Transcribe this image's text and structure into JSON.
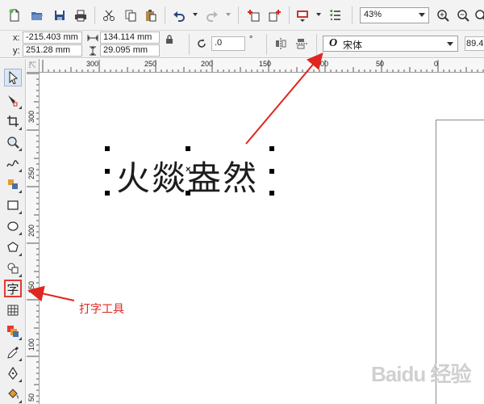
{
  "toolbar": {
    "zoom_value": "43%",
    "icons": [
      "new-document-icon",
      "open-folder-icon",
      "save-icon",
      "print-icon",
      "cut-icon",
      "copy-icon",
      "paste-icon",
      "undo-icon",
      "redo-icon",
      "import-icon",
      "export-icon",
      "application-launcher-icon",
      "options-icon",
      "zoom-in-icon",
      "zoom-out-icon"
    ]
  },
  "property_bar": {
    "x_label": "x:",
    "x_value": "-215.403 mm",
    "y_label": "y:",
    "y_value": "251.28 mm",
    "width_value": "134.114 mm",
    "height_value": "29.095 mm",
    "angle_value": ".0",
    "angle_unit": "°",
    "font_name": "宋体",
    "font_size": "89.4"
  },
  "toolbox": {
    "tools": [
      "pick-tool",
      "shape-tool",
      "crop-tool",
      "zoom-tool",
      "freehand-tool",
      "smart-fill-tool",
      "rectangle-tool",
      "ellipse-tool",
      "polygon-tool",
      "basic-shapes-tool",
      "text-tool",
      "table-tool",
      "interactive-effects-tool",
      "eyedropper-tool",
      "outline-tool",
      "fill-tool"
    ]
  },
  "ruler": {
    "h_labels": [
      "300",
      "250",
      "200",
      "150",
      "100",
      "50",
      "0"
    ],
    "v_labels": [
      "300",
      "250",
      "200",
      "150",
      "100",
      "50"
    ]
  },
  "canvas": {
    "text_object": "火燚盎然",
    "annotation": "打字工具",
    "watermark": "Baidu 经验"
  },
  "colors": {
    "annotation_red": "#e0261f",
    "selection_bg": "#dce6f4"
  }
}
